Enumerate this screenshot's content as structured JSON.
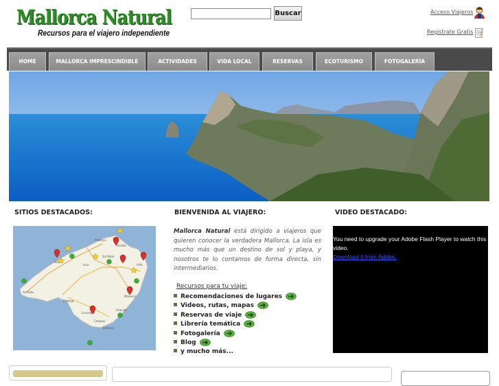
{
  "header": {
    "logo_title": "Mallorca Natural",
    "logo_subtitle": "Recursos para el viajero independiente",
    "search": {
      "placeholder": "",
      "value": "",
      "button_label": "Buscar"
    },
    "access_link": "Acceso Viajeros",
    "register_link": "Registrate Gratis"
  },
  "nav": {
    "items": [
      "HOME",
      "MALLORCA IMPRESCINDIBLE",
      "ACTIVIDADES",
      "VIDA LOCAL",
      "RESERVAS",
      "ECOTURISMO",
      "FOTOGALERÍA"
    ]
  },
  "sections": {
    "featured_sites": "SITIOS DESTACADOS:",
    "welcome": "BIENVENIDA AL VIAJERO:",
    "featured_video": "VIDEO DESTACADO:"
  },
  "welcome": {
    "brand": "Mallorca Natural",
    "text": " está dirigido a viajeros que quieren conocer la verdadera Mallorca. La isla es mucho más que un destino de sol y playa, y nosotros te lo contamos de forma directa, sin intermediarios.",
    "resources_title": "Recursos para tu viaje:",
    "resources": [
      "Recomendaciones de lugares",
      "Videos, rutas, mapas",
      "Reservas de viaje",
      "Librería temática",
      "Fotogalería",
      "Blog",
      "y mucho más..."
    ]
  },
  "map_labels": [
    "Pollença",
    "Alcúdia",
    "Sóller",
    "Palma",
    "Manacor",
    "Felanitx",
    "Santanyí",
    "Llucmajor",
    "Inca",
    "Sa Pobla",
    "Artà",
    "Andratx",
    "Campos"
  ],
  "video": {
    "message": "You need to upgrade your Adobe Flash Player to watch this video.",
    "link": "Download it from Adobe."
  },
  "colors": {
    "logo_green": "#2f8a2a",
    "nav_bg": "#4a4a4a",
    "tab_bg": "#979797",
    "bullet": "#6f6b3a"
  }
}
